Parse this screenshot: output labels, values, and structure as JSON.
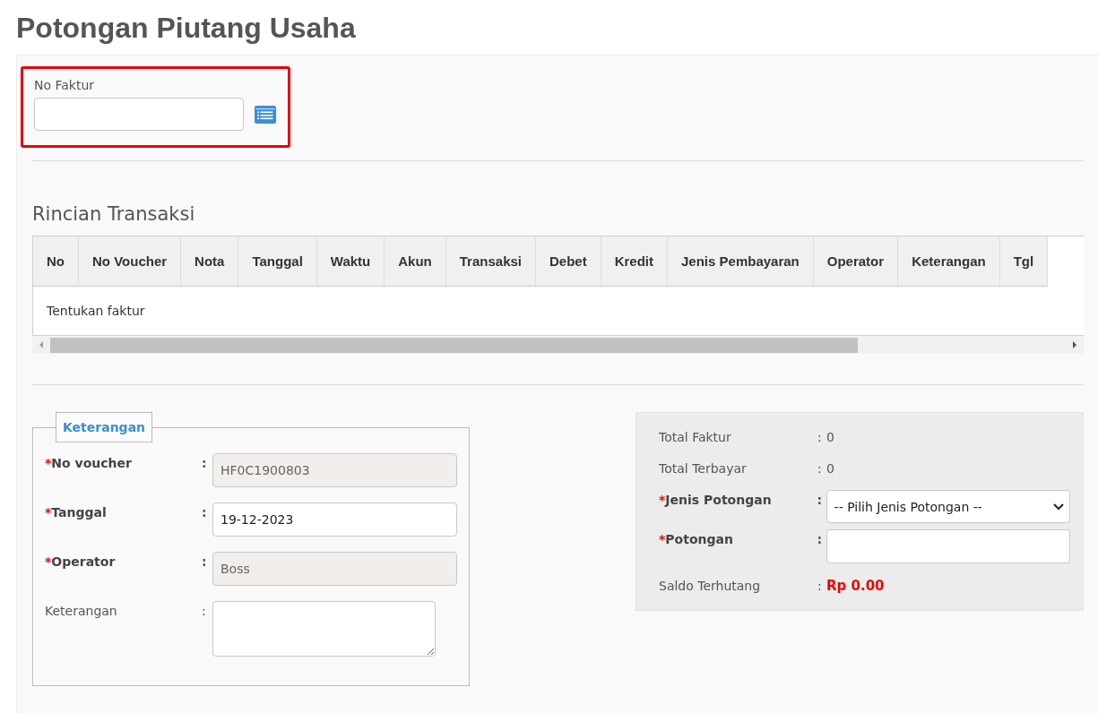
{
  "page": {
    "title": "Potongan Piutang Usaha"
  },
  "invoice_lookup": {
    "label": "No Faktur",
    "highlighted": true
  },
  "transactions": {
    "title": "Rincian Transaksi",
    "columns": [
      "No",
      "No Voucher",
      "Nota",
      "Tanggal",
      "Waktu",
      "Akun",
      "Transaksi",
      "Debet",
      "Kredit",
      "Jenis Pembayaran",
      "Operator",
      "Keterangan",
      "Tgl"
    ],
    "empty_message": "Tentukan faktur"
  },
  "details": {
    "legend": "Keterangan",
    "fields": [
      {
        "kind": "input",
        "required_mark": "*",
        "label": "No voucher",
        "separator": ":",
        "value": "HF0C1900803",
        "disabled": true
      },
      {
        "kind": "input",
        "required_mark": "*",
        "label": "Tanggal",
        "separator": ":",
        "value": "19-12-2023",
        "disabled": false
      },
      {
        "kind": "input",
        "required_mark": "*",
        "label": "Operator",
        "separator": ":",
        "value": "Boss",
        "disabled": true
      },
      {
        "kind": "textarea",
        "label": "Keterangan",
        "separator": ":",
        "disabled": false
      }
    ]
  },
  "summary": {
    "rows": [
      {
        "kind": "text",
        "label": "Total Faktur",
        "separator": ":",
        "value": "0"
      },
      {
        "kind": "text",
        "label": "Total Terbayar",
        "separator": ":",
        "value": "0"
      },
      {
        "kind": "select",
        "required_mark": "*",
        "label": "Jenis Potongan",
        "separator": ":",
        "value": "-- Pilih Jenis Potongan --"
      },
      {
        "kind": "input",
        "required_mark": "*",
        "label": "Potongan",
        "separator": ":"
      },
      {
        "kind": "total",
        "label": "Saldo Terhutang",
        "separator": ":",
        "value": "Rp 0.00"
      }
    ]
  }
}
